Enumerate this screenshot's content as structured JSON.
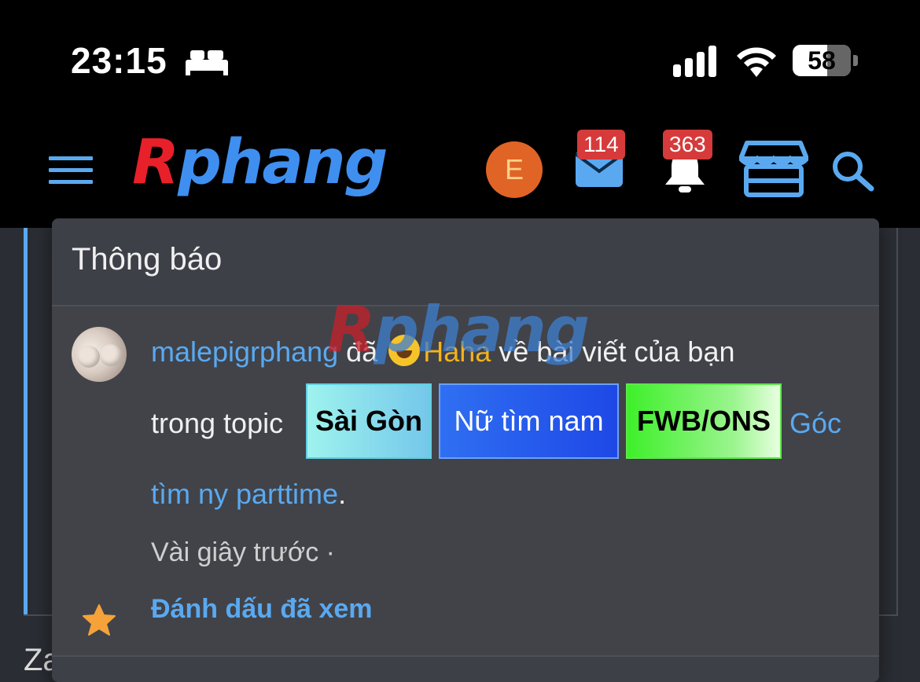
{
  "status_bar": {
    "time": "23:15",
    "battery": "58",
    "icons": [
      "bed-icon",
      "signal-icon",
      "wifi-icon",
      "battery-icon"
    ]
  },
  "header": {
    "logo_part1": "R",
    "logo_part2": "phang",
    "avatar_letter": "E",
    "mail_count": "114",
    "notification_count": "363",
    "icons": [
      "menu-icon",
      "mail-icon",
      "bell-icon",
      "store-icon",
      "search-icon"
    ]
  },
  "panel": {
    "title": "Thông báo",
    "notification": {
      "username": "malepigrphang",
      "action": " đã ",
      "reaction": "Haha",
      "action_rest": " về bài viết của bạn",
      "in_topic": "trong topic ",
      "tags": [
        "Sài Gòn",
        "Nữ tìm nam",
        "FWB/ONS"
      ],
      "topic_start": "Góc",
      "topic_end": "tìm ny parttime",
      "period": ".",
      "time_ago": "Vài giây trước ·",
      "mark_read": "Đánh dấu đã xem"
    }
  },
  "watermark": {
    "part1": "R",
    "part2": "phang"
  },
  "background": {
    "partial_text": "Za"
  },
  "colors": {
    "accent": "#5aa9f0",
    "badge": "#d63a3a",
    "reaction": "#f3b31b",
    "avatar": "#e06426"
  }
}
